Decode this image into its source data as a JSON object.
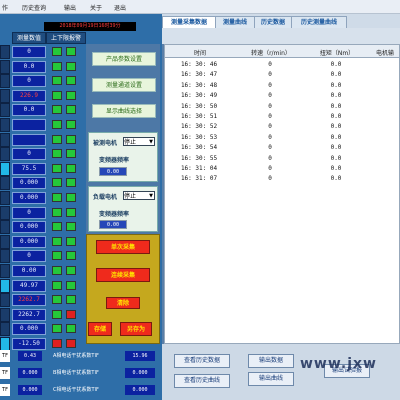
{
  "menu": [
    "作",
    "历史查询",
    "输出",
    "关于",
    "退出"
  ],
  "datetime": "2018年09月19日16时39分",
  "left_headers": {
    "value": "测量数值",
    "limits": "上下限报警"
  },
  "readings": [
    {
      "value": "0",
      "red": false,
      "lamps": [
        "g",
        "g"
      ]
    },
    {
      "value": "0.0",
      "red": false,
      "lamps": [
        "g",
        "g"
      ]
    },
    {
      "value": "0",
      "red": false,
      "lamps": [
        "g",
        "g"
      ]
    },
    {
      "value": "226.9",
      "red": true,
      "lamps": [
        "g",
        "g"
      ]
    },
    {
      "value": "0.0",
      "red": false,
      "lamps": [
        "g",
        "g"
      ]
    },
    {
      "value": "",
      "red": false,
      "lamps": [
        "g",
        "g"
      ]
    },
    {
      "value": "",
      "red": false,
      "lamps": [
        "g",
        "g"
      ]
    },
    {
      "value": "0",
      "red": false,
      "lamps": [
        "g",
        "g"
      ]
    },
    {
      "value": "75.5",
      "red": false,
      "lamps": [
        "g",
        "g"
      ]
    },
    {
      "value": "0.000",
      "red": false,
      "lamps": [
        "g",
        "g"
      ]
    },
    {
      "value": "0.000",
      "red": false,
      "lamps": [
        "g",
        "g"
      ]
    },
    {
      "value": "0",
      "red": false,
      "lamps": [
        "g",
        "g"
      ]
    },
    {
      "value": "0.000",
      "red": false,
      "lamps": [
        "g",
        "g"
      ]
    },
    {
      "value": "0.000",
      "red": false,
      "lamps": [
        "g",
        "g"
      ]
    },
    {
      "value": "0",
      "red": false,
      "lamps": [
        "g",
        "g"
      ]
    },
    {
      "value": "0.00",
      "red": false,
      "lamps": [
        "g",
        "g"
      ]
    },
    {
      "value": "49.97",
      "red": false,
      "lamps": [
        "g",
        "g"
      ]
    },
    {
      "value": "2262.7",
      "red": true,
      "lamps": [
        "g",
        "g"
      ]
    },
    {
      "value": "2262.7",
      "red": false,
      "lamps": [
        "g",
        "r"
      ]
    },
    {
      "value": "0.000",
      "red": false,
      "lamps": [
        "g",
        "g"
      ]
    },
    {
      "value": "-12.50",
      "red": false,
      "lamps": [
        "r",
        "r"
      ]
    }
  ],
  "buttons": {
    "product_params": "产品参数设置",
    "channel_setup": "测量通道设置",
    "curve_select": "显示曲线选择"
  },
  "motor_test": {
    "label": "被测电机",
    "state": "停止",
    "freq_label": "变频器频率",
    "freq": "0.00"
  },
  "motor_load": {
    "label": "负载电机",
    "state": "停止",
    "freq_label": "变频器频率",
    "freq": "0.00"
  },
  "actions": {
    "single_collect": "单次采集",
    "continuous_collect": "连续采集",
    "clear": "清除",
    "save": "存储",
    "save_as": "另存为"
  },
  "tf_rows": [
    {
      "label": "TF",
      "value": "0.43",
      "name": "A相电话干扰系数TIF",
      "b": "15.96"
    },
    {
      "label": "TF",
      "value": "0.000",
      "name": "B相电话干扰系数TIF",
      "b": "0.000"
    },
    {
      "label": "TF",
      "value": "0.000",
      "name": "C相电话干扰系数TIF",
      "b": "0.000"
    }
  ],
  "tabs": [
    "测量采集数据",
    "测量曲线",
    "历史数据",
    "历史测量曲线"
  ],
  "table": {
    "headers": [
      "时间",
      "转速（r/min）",
      "扭矩（Nm）",
      "电机输"
    ],
    "rows": [
      [
        "16: 30: 46",
        "0",
        "0.0",
        ""
      ],
      [
        "16: 30: 47",
        "0",
        "0.0",
        ""
      ],
      [
        "16: 30: 48",
        "0",
        "0.0",
        ""
      ],
      [
        "16: 30: 49",
        "0",
        "0.0",
        ""
      ],
      [
        "16: 30: 50",
        "0",
        "0.0",
        ""
      ],
      [
        "16: 30: 51",
        "0",
        "0.0",
        ""
      ],
      [
        "16: 30: 52",
        "0",
        "0.0",
        ""
      ],
      [
        "16: 30: 53",
        "0",
        "0.0",
        ""
      ],
      [
        "16: 30: 54",
        "0",
        "0.0",
        ""
      ],
      [
        "16: 30: 55",
        "0",
        "0.0",
        ""
      ],
      [
        "16: 31: 04",
        "0",
        "0.0",
        ""
      ],
      [
        "16: 31: 07",
        "0",
        "0.0",
        ""
      ]
    ]
  },
  "bottom_buttons": {
    "view_history_data": "查看历史数据",
    "output_data": "输出数据",
    "view_history_curve": "查看历史曲线",
    "output_curve": "输出曲线",
    "output_test": "输出试验报"
  },
  "watermark": "www.jxw"
}
